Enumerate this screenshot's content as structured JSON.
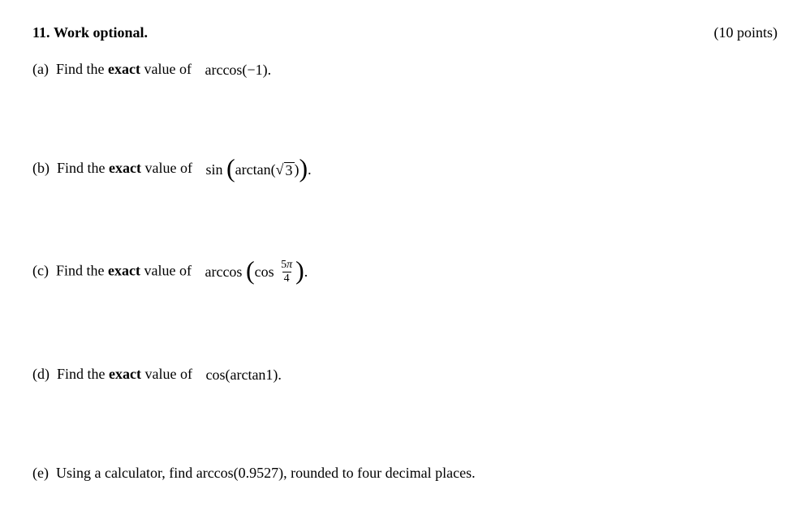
{
  "header": {
    "number": "11.",
    "title": "Work optional.",
    "points": "(10 points)"
  },
  "parts": {
    "a": {
      "label": "(a)",
      "prompt_before": "Find the ",
      "bold": "exact",
      "prompt_after": " value of",
      "expr": "arccos(−1)."
    },
    "b": {
      "label": "(b)",
      "prompt_before": "Find the ",
      "bold": "exact",
      "prompt_after": " value of",
      "outer": "sin",
      "inner": "arctan",
      "sqrt_sym": "√",
      "sqrt_val": "3",
      "end": "."
    },
    "c": {
      "label": "(c)",
      "prompt_before": "Find the ",
      "bold": "exact",
      "prompt_after": " value of",
      "outer": "arccos",
      "inner": "cos",
      "frac_num": "5π",
      "frac_den": "4",
      "end": "."
    },
    "d": {
      "label": "(d)",
      "prompt_before": "Find the ",
      "bold": "exact",
      "prompt_after": " value of",
      "expr": "cos(arctan1)."
    },
    "e": {
      "label": "(e)",
      "text": "Using a calculator, find arccos(0.9527), rounded to four decimal places."
    }
  }
}
